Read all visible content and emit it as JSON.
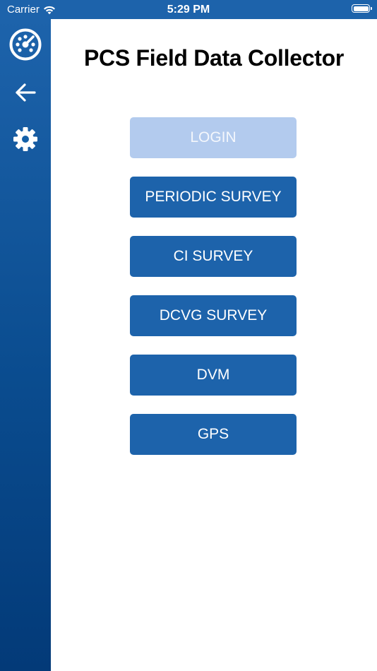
{
  "status_bar": {
    "carrier": "Carrier",
    "time": "5:29 PM"
  },
  "sidebar": {
    "items": [
      {
        "icon": "dashboard-icon"
      },
      {
        "icon": "back-arrow-icon"
      },
      {
        "icon": "gear-icon"
      }
    ]
  },
  "main": {
    "title": "PCS Field Data Collector",
    "buttons": [
      {
        "label": "LOGIN",
        "enabled": false
      },
      {
        "label": "PERIODIC SURVEY",
        "enabled": true
      },
      {
        "label": "CI SURVEY",
        "enabled": true
      },
      {
        "label": "DCVG SURVEY",
        "enabled": true
      },
      {
        "label": "DVM",
        "enabled": true
      },
      {
        "label": "GPS",
        "enabled": true
      }
    ]
  },
  "colors": {
    "primary": "#1d63ab",
    "disabled_button": "#b3cbee",
    "sidebar_bottom": "#033a78"
  }
}
